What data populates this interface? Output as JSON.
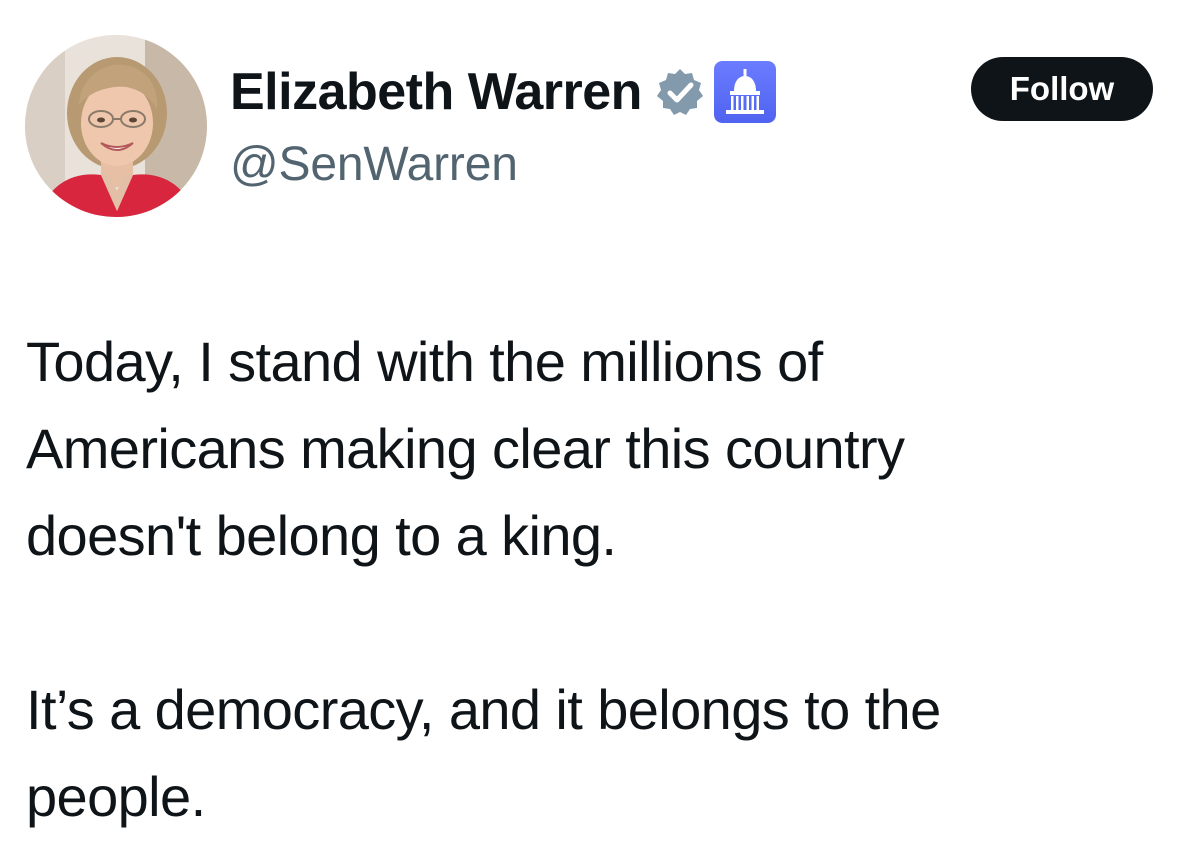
{
  "author": {
    "display_name": "Elizabeth Warren",
    "handle": "@SenWarren",
    "avatar_icon": "profile-photo",
    "verified_badge_icon": "verified-badge-icon",
    "verified_badge_color": "#829aab",
    "affiliation_icon": "capitol-building-icon",
    "affiliation_color": "#5b6ef5"
  },
  "follow_button": {
    "label": "Follow",
    "background": "#0f1419",
    "text_color": "#ffffff"
  },
  "tweet": {
    "paragraphs": [
      {
        "lines": [
          "Today, I stand with the millions of",
          "Americans making clear this country",
          "doesn't belong to a king."
        ]
      },
      {
        "lines": [
          "It’s a democracy, and it belongs to the",
          "people."
        ]
      }
    ]
  }
}
